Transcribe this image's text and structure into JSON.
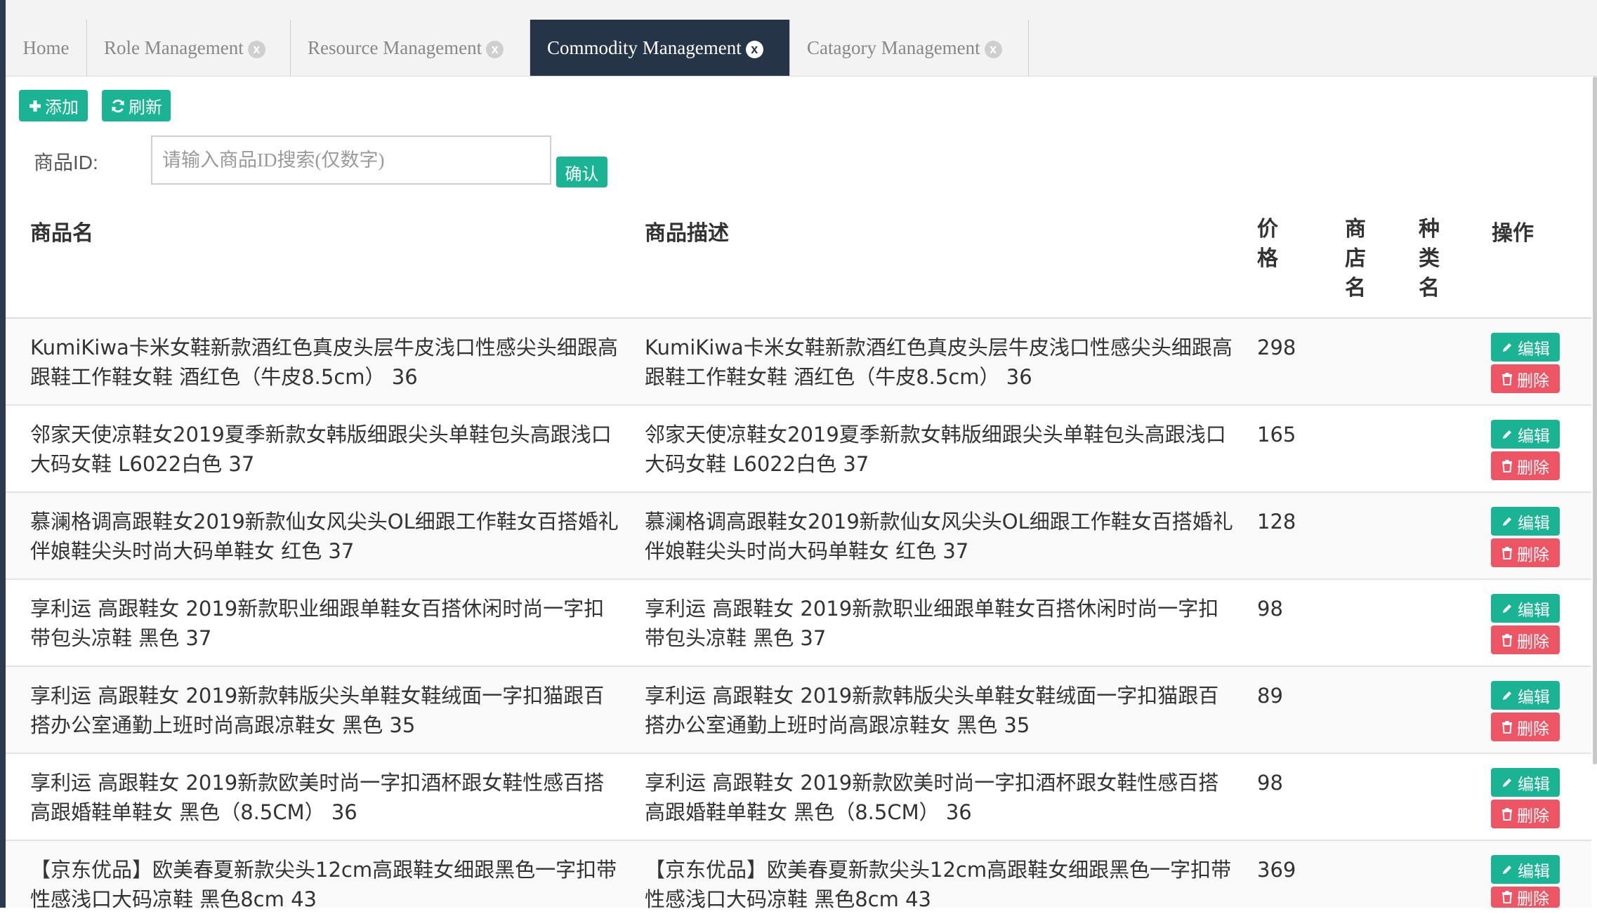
{
  "tabs": [
    {
      "label": "Home",
      "closable": false,
      "active": false
    },
    {
      "label": "Role Management",
      "closable": true,
      "active": false
    },
    {
      "label": "Resource Management",
      "closable": true,
      "active": false
    },
    {
      "label": "Commodity Management",
      "closable": true,
      "active": true
    },
    {
      "label": "Catagory Management",
      "closable": true,
      "active": false
    }
  ],
  "tab_close_glyph": "x",
  "toolbar": {
    "add_label": "添加",
    "refresh_label": "刷新"
  },
  "search": {
    "label": "商品ID:",
    "placeholder": "请输入商品ID搜索(仅数字)",
    "value": "",
    "confirm_label": "确认"
  },
  "table": {
    "headers": {
      "name": "商品名",
      "desc": "商品描述",
      "price": "价格",
      "shop": "商店名",
      "category": "种类名",
      "actions": "操作"
    },
    "edit_label": "编辑",
    "delete_label": "删除",
    "rows": [
      {
        "name": "KumiKiwa卡米女鞋新款酒红色真皮头层牛皮浅口性感尖头细跟高跟鞋工作鞋女鞋 酒红色（牛皮8.5cm） 36",
        "desc": "KumiKiwa卡米女鞋新款酒红色真皮头层牛皮浅口性感尖头细跟高跟鞋工作鞋女鞋 酒红色（牛皮8.5cm） 36",
        "price": "298",
        "shop": "",
        "category": ""
      },
      {
        "name": "邻家天使凉鞋女2019夏季新款女韩版细跟尖头单鞋包头高跟浅口大码女鞋 L6022白色 37",
        "desc": "邻家天使凉鞋女2019夏季新款女韩版细跟尖头单鞋包头高跟浅口大码女鞋 L6022白色 37",
        "price": "165",
        "shop": "",
        "category": ""
      },
      {
        "name": "慕澜格调高跟鞋女2019新款仙女风尖头OL细跟工作鞋女百搭婚礼伴娘鞋尖头时尚大码单鞋女 红色 37",
        "desc": "慕澜格调高跟鞋女2019新款仙女风尖头OL细跟工作鞋女百搭婚礼伴娘鞋尖头时尚大码单鞋女 红色 37",
        "price": "128",
        "shop": "",
        "category": ""
      },
      {
        "name": "享利运 高跟鞋女 2019新款职业细跟单鞋女百搭休闲时尚一字扣带包头凉鞋 黑色 37",
        "desc": "享利运 高跟鞋女 2019新款职业细跟单鞋女百搭休闲时尚一字扣带包头凉鞋 黑色 37",
        "price": "98",
        "shop": "",
        "category": ""
      },
      {
        "name": "享利运 高跟鞋女 2019新款韩版尖头单鞋女鞋绒面一字扣猫跟百搭办公室通勤上班时尚高跟凉鞋女 黑色 35",
        "desc": "享利运 高跟鞋女 2019新款韩版尖头单鞋女鞋绒面一字扣猫跟百搭办公室通勤上班时尚高跟凉鞋女 黑色 35",
        "price": "89",
        "shop": "",
        "category": ""
      },
      {
        "name": "享利运 高跟鞋女 2019新款欧美时尚一字扣酒杯跟女鞋性感百搭高跟婚鞋单鞋女 黑色（8.5CM） 36",
        "desc": "享利运 高跟鞋女 2019新款欧美时尚一字扣酒杯跟女鞋性感百搭高跟婚鞋单鞋女 黑色（8.5CM） 36",
        "price": "98",
        "shop": "",
        "category": ""
      },
      {
        "name": "【京东优品】欧美春夏新款尖头12cm高跟鞋女细跟黑色一字扣带性感浅口大码凉鞋 黑色8cm 43",
        "desc": "【京东优品】欧美春夏新款尖头12cm高跟鞋女细跟黑色一字扣带性感浅口大码凉鞋 黑色8cm 43",
        "price": "369",
        "shop": "",
        "category": ""
      }
    ]
  },
  "colors": {
    "primary": "#1ab394",
    "danger": "#ed5565",
    "active_tab": "#253446",
    "tabbar": "#f3f3f3"
  },
  "icons": {
    "add": "plus-icon",
    "refresh": "refresh-icon",
    "edit": "pencil-icon",
    "delete": "trash-icon"
  }
}
